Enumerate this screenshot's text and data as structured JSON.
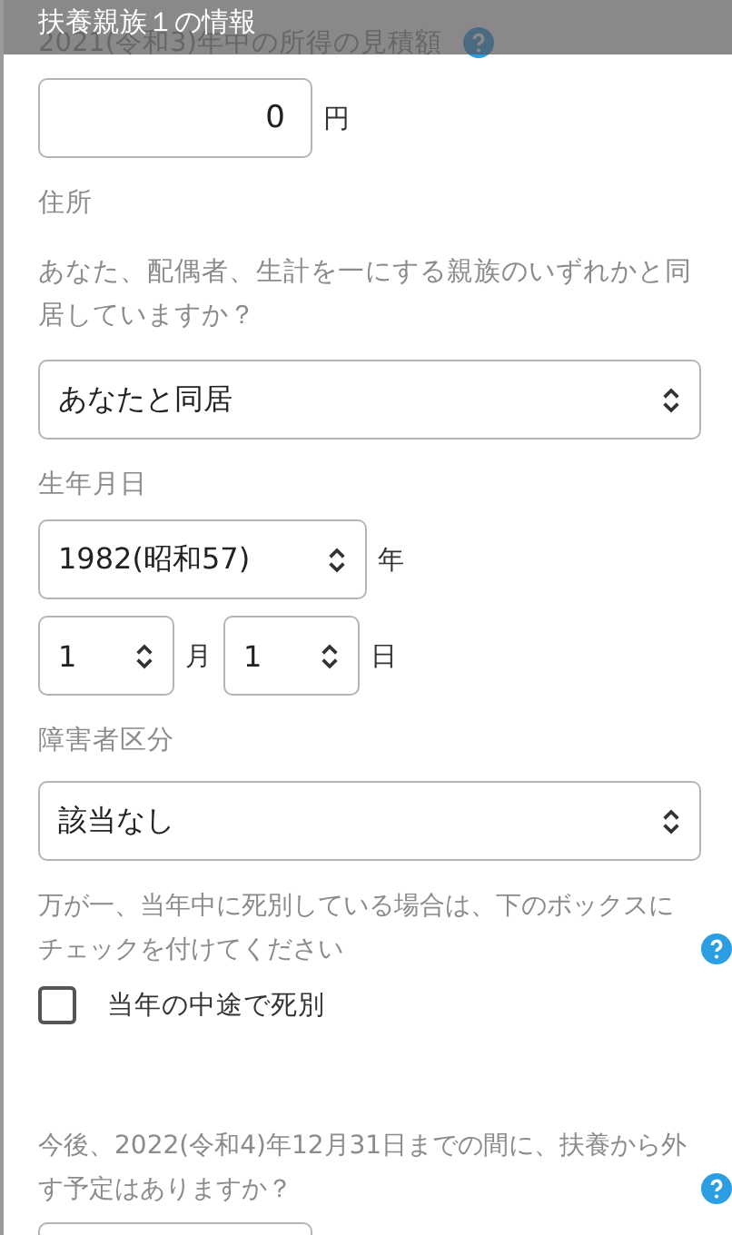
{
  "header": {
    "title": "扶養親族１の情報"
  },
  "sections": [
    {
      "kind": "amount",
      "label": "2021(令和3)年中の所得の見積額",
      "help": true,
      "value": "0",
      "unit": "円"
    },
    {
      "kind": "select",
      "label": "住所",
      "question": "あなた、配偶者、生計を一にする親族のいずれかと同居していますか？",
      "value": "あなたと同居"
    },
    {
      "kind": "date",
      "label": "生年月日",
      "year": {
        "value": "1982(昭和57)",
        "unit": "年"
      },
      "month": {
        "value": "1",
        "unit": "月"
      },
      "day": {
        "value": "1",
        "unit": "日"
      }
    },
    {
      "kind": "select",
      "label": "障害者区分",
      "value": "該当なし"
    },
    {
      "kind": "check",
      "question": "万が一、当年中に死別している場合は、下のボックスにチェックを付けてください",
      "help": true,
      "checkbox": {
        "label": "当年の中途で死別",
        "checked": false
      }
    },
    {
      "kind": "partial",
      "question": "今後、2022(令和4)年12月31日までの間に、扶養から外す予定はありますか？",
      "help": true
    }
  ]
}
